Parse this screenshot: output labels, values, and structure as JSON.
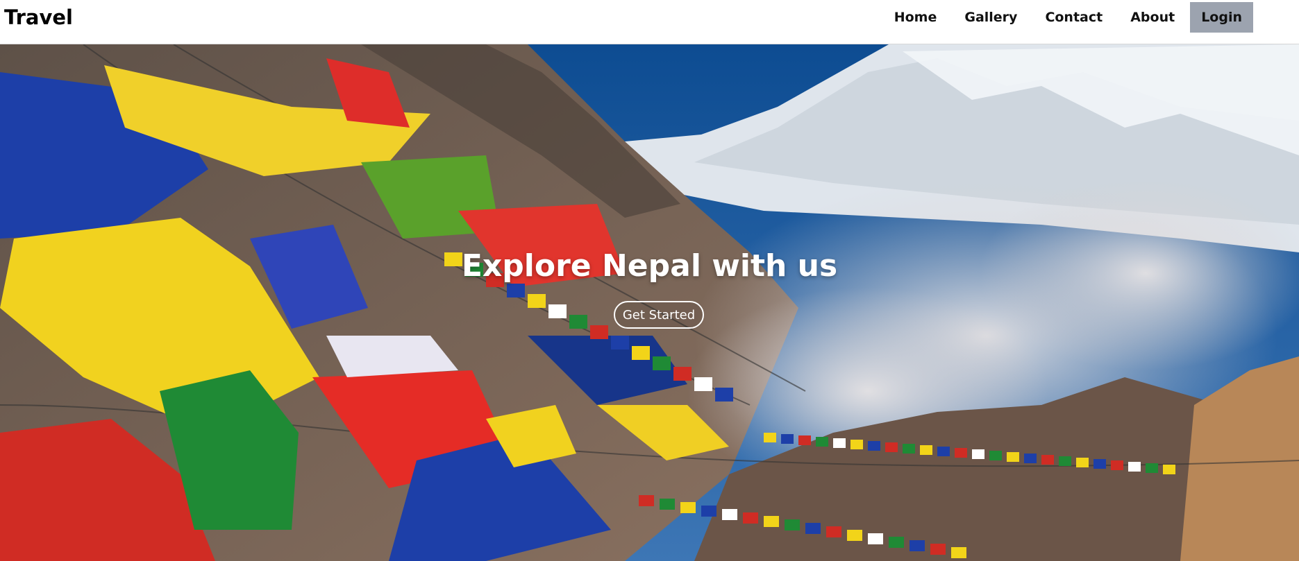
{
  "header": {
    "brand": "Travel",
    "nav": [
      {
        "label": "Home"
      },
      {
        "label": "Gallery"
      },
      {
        "label": "Contact"
      },
      {
        "label": "About"
      }
    ],
    "login_label": "Login"
  },
  "hero": {
    "title": "Explore Nepal with us",
    "cta_label": "Get Started"
  },
  "colors": {
    "login_bg": "#9ca3af",
    "header_bg": "#ffffff",
    "hero_text": "#ffffff"
  }
}
